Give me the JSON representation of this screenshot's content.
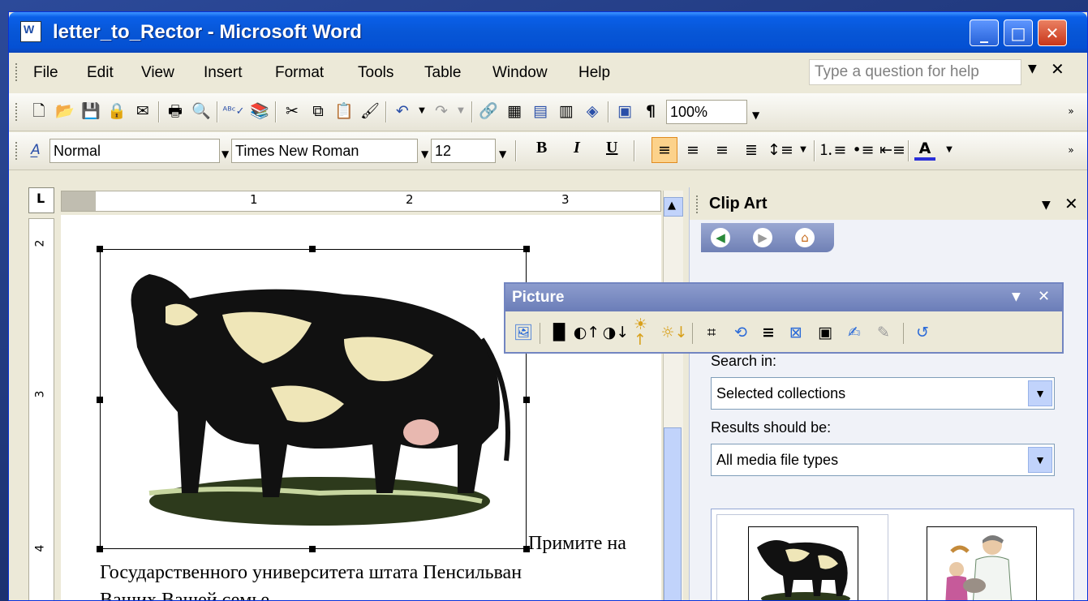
{
  "window": {
    "title": "letter_to_Rector - Microsoft Word",
    "min_glyph": "_",
    "max_glyph": "□",
    "close_glyph": "✕"
  },
  "menu": {
    "items": [
      "File",
      "Edit",
      "View",
      "Insert",
      "Format",
      "Tools",
      "Table",
      "Window",
      "Help"
    ],
    "help_placeholder": "Type a question for help",
    "help_close": "✕"
  },
  "standard_toolbar": {
    "zoom": "100%",
    "icons": [
      "new-icon",
      "open-icon",
      "save-icon",
      "permission-icon",
      "email-icon",
      "print-icon",
      "print-preview-icon",
      "spelling-icon",
      "research-icon",
      "cut-icon",
      "copy-icon",
      "paste-icon",
      "format-painter-icon",
      "undo-icon",
      "redo-icon",
      "hyperlink-icon",
      "tables-borders-icon",
      "insert-table-icon",
      "columns-icon",
      "drawing-icon",
      "document-map-icon",
      "show-formatting-icon"
    ]
  },
  "formatting_toolbar": {
    "style": "Normal",
    "font": "Times New Roman",
    "size": "12",
    "bold": "B",
    "italic": "I",
    "underline": "U",
    "icons": [
      "styles-icon",
      "align-left-icon",
      "center-icon",
      "align-right-icon",
      "justify-icon",
      "line-spacing-icon",
      "numbering-icon",
      "bullets-icon",
      "decrease-indent-icon",
      "font-color-icon"
    ]
  },
  "ruler": {
    "h_numbers": [
      "1",
      "2",
      "3"
    ],
    "v_numbers": [
      "2",
      "3",
      "4"
    ]
  },
  "document": {
    "line1": "Примите на",
    "line2": "Государственного университета штата Пенсильван",
    "line3": "Ваших Вашей семье"
  },
  "task_pane": {
    "title": "Clip Art",
    "search_in_label": "Search in:",
    "search_in_value": "Selected collections",
    "results_label": "Results should be:",
    "results_value": "All media file types",
    "nav": [
      "back-icon",
      "forward-icon",
      "home-icon"
    ]
  },
  "picture_toolbar": {
    "title": "Picture",
    "icons": [
      "insert-picture-icon",
      "color-icon",
      "more-contrast-icon",
      "less-contrast-icon",
      "more-brightness-icon",
      "less-brightness-icon",
      "crop-icon",
      "rotate-left-icon",
      "line-style-icon",
      "compress-pictures-icon",
      "text-wrapping-icon",
      "format-picture-icon",
      "set-transparent-color-icon",
      "reset-picture-icon"
    ]
  },
  "colors": {
    "titlebar": "#0a5fe8",
    "chrome": "#ece9d8",
    "pane": "#f0f2f8",
    "picture_toolbar_head": "#7285c1"
  }
}
